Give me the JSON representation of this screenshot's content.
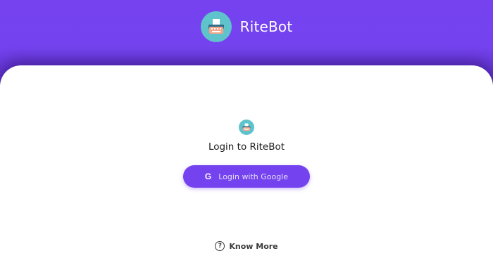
{
  "header": {
    "brand_name": "RiteBot",
    "logo_icon": "typewriter-icon"
  },
  "login": {
    "logo_icon": "typewriter-icon",
    "title": "Login to RiteBot",
    "google_button_label": "Login with Google",
    "google_icon": "google-icon",
    "google_icon_glyph": "G"
  },
  "footer": {
    "know_more_label": "Know More",
    "help_icon": "question-circle-icon",
    "help_icon_glyph": "?"
  },
  "colors": {
    "brand_purple": "#7443ef",
    "logo_teal": "#5fc3cc",
    "white": "#ffffff"
  }
}
